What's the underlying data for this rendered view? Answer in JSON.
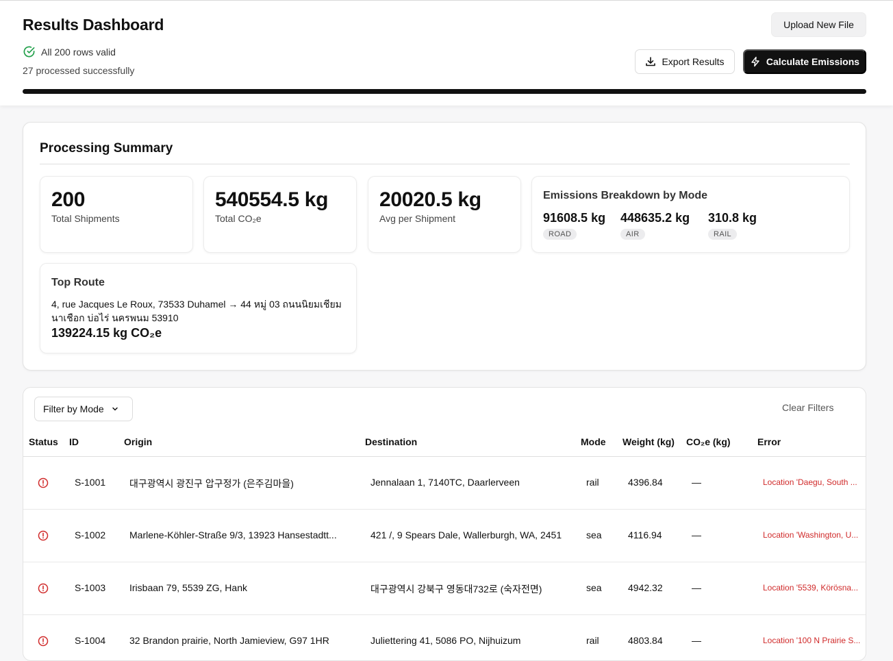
{
  "header": {
    "title": "Results Dashboard",
    "valid_text": "All 200 rows valid",
    "processed_text": "27 processed successfully",
    "upload_label": "Upload New File",
    "export_label": "Export Results",
    "calc_label": "Calculate Emissions",
    "progress_fraction": 1.0
  },
  "summary": {
    "title": "Processing Summary",
    "stats": [
      {
        "value": "200",
        "label": "Total Shipments"
      },
      {
        "value": "540554.5 kg",
        "label": "Total CO₂e"
      },
      {
        "value": "20020.5 kg",
        "label": "Avg per Shipment"
      }
    ],
    "breakdown": {
      "title": "Emissions Breakdown by Mode",
      "items": [
        {
          "value": "91608.5 kg",
          "mode": "ROAD"
        },
        {
          "value": "448635.2 kg",
          "mode": "AIR"
        },
        {
          "value": "310.8 kg",
          "mode": "RAIL"
        }
      ]
    },
    "top_route": {
      "title": "Top Route",
      "route": "4, rue Jacques Le Roux, 73533 Duhamel → 44 หมู่ 03 ถนนนิยมเชียม นาเชือก บ่อไร่ นครพนม 53910",
      "value": "139224.15 kg CO₂e"
    }
  },
  "table": {
    "filter_label": "Filter by Mode",
    "clear_label": "Clear Filters",
    "columns": [
      "Status",
      "ID",
      "Origin",
      "Destination",
      "Mode",
      "Weight (kg)",
      "CO₂e (kg)",
      "Error"
    ],
    "rows": [
      {
        "id": "S-1001",
        "origin": "대구광역시 광진구 압구정가 (은주김마을)",
        "destination": "Jennalaan 1, 7140TC, Daarlerveen",
        "mode": "rail",
        "weight": "4396.84",
        "co2e": "—",
        "error": "Location 'Daegu, South ..."
      },
      {
        "id": "S-1002",
        "origin": "Marlene-Köhler-Straße 9/3, 13923 Hansestadtt...",
        "destination": "421 /, 9 Spears Dale, Wallerburgh, WA, 2451",
        "mode": "sea",
        "weight": "4116.94",
        "co2e": "—",
        "error": "Location 'Washington, U..."
      },
      {
        "id": "S-1003",
        "origin": "Irisbaan 79, 5539 ZG, Hank",
        "destination": "대구광역시 강북구 영동대732로 (숙자전면)",
        "mode": "sea",
        "weight": "4942.32",
        "co2e": "—",
        "error": "Location '5539, Körösna..."
      },
      {
        "id": "S-1004",
        "origin": "32 Brandon prairie, North Jamieview, G97 1HR",
        "destination": "Juliettering 41, 5086 PO, Nijhuizum",
        "mode": "rail",
        "weight": "4803.84",
        "co2e": "—",
        "error": "Location '100 N Prairie S..."
      }
    ]
  },
  "colors": {
    "accent": "#111111",
    "valid": "#22a04b",
    "error": "#d02a2a"
  }
}
